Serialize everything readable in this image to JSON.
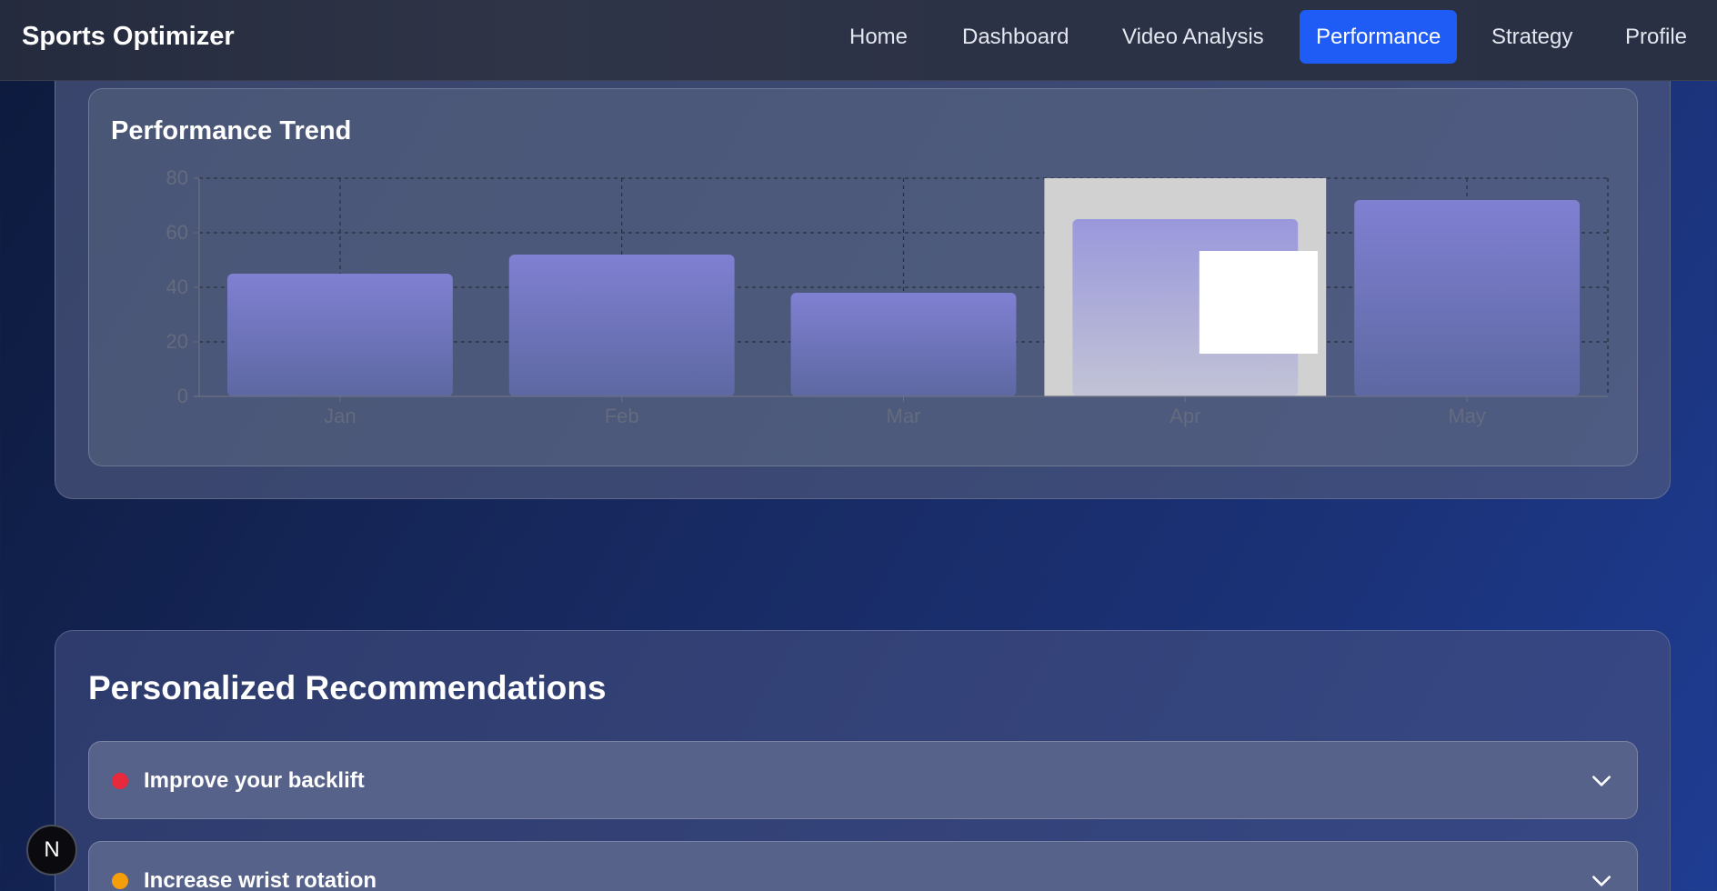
{
  "app": {
    "brand": "Sports Optimizer"
  },
  "nav": {
    "items": [
      {
        "label": "Home",
        "active": false
      },
      {
        "label": "Dashboard",
        "active": false
      },
      {
        "label": "Video Analysis",
        "active": false
      },
      {
        "label": "Performance",
        "active": true
      },
      {
        "label": "Strategy",
        "active": false
      },
      {
        "label": "Profile",
        "active": false
      }
    ]
  },
  "performance": {
    "title": "Performance Trend"
  },
  "chart_data": {
    "type": "bar",
    "categories": [
      "Jan",
      "Feb",
      "Mar",
      "Apr",
      "May"
    ],
    "values": [
      45,
      52,
      38,
      65,
      72
    ],
    "title": "Performance Trend",
    "xlabel": "",
    "ylabel": "",
    "ylim": [
      0,
      80
    ],
    "yticks": [
      0,
      20,
      40,
      60,
      80
    ],
    "grid": true,
    "highlighted_category": "Apr",
    "colors": {
      "bar_top": "#7f7fd0",
      "bar_bottom": "#5f6aa4",
      "highlight": "#d1d1d1"
    }
  },
  "recommendations": {
    "title": "Personalized Recommendations",
    "items": [
      {
        "label": "Improve your backlift",
        "priority_color": "#e8283b"
      },
      {
        "label": "Increase wrist rotation",
        "priority_color": "#f59e0b"
      }
    ]
  },
  "badge": {
    "text": "N"
  },
  "colors": {
    "accent": "#1f5cf5"
  }
}
